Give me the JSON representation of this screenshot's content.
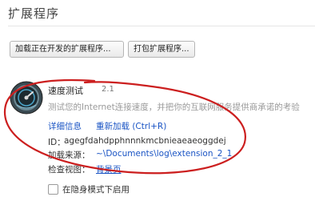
{
  "page": {
    "title": "扩展程序"
  },
  "toolbar": {
    "load_unpacked_label": "加载正在开发的扩展程序...",
    "pack_label": "打包扩展程序..."
  },
  "extension": {
    "icon": "speedometer-icon",
    "name": "速度测试",
    "version": "2.1",
    "description": "测试您的Internet连接速度，并把你的互联网服务提供商承诺的考验",
    "links": {
      "details": "详细信息",
      "reload": "重新加载 (Ctrl+R)"
    },
    "id_label": "ID：",
    "id_value": "agegfdahdpphnnnkmcbnieaeaeoggdej",
    "source_label": "加载来源：",
    "source_value": "~\\Documents\\log\\extension_2_1",
    "inspect_label": "检查视图：",
    "inspect_value": "背景页",
    "incognito_label": "在隐身模式下启用"
  },
  "colors": {
    "link": "#1a54c4",
    "annotation": "#cc1f1f"
  }
}
